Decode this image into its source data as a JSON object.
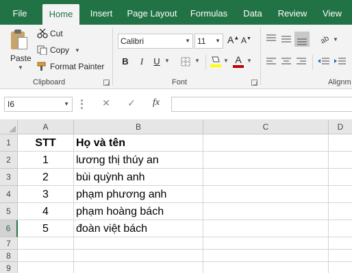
{
  "tabs": [
    "File",
    "Home",
    "Insert",
    "Page Layout",
    "Formulas",
    "Data",
    "Review",
    "View"
  ],
  "active_tab": "Home",
  "clipboard": {
    "paste_label": "Paste",
    "cut_label": "Cut",
    "copy_label": "Copy",
    "format_painter_label": "Format Painter",
    "group_label": "Clipboard"
  },
  "font": {
    "font_name": "Calibri",
    "font_size": "11",
    "bold": "B",
    "italic": "I",
    "underline": "U",
    "grow": "A",
    "shrink": "A",
    "font_color_letter": "A",
    "group_label": "Font"
  },
  "alignment": {
    "group_label": "Alignm"
  },
  "formula_bar": {
    "name_box": "I6",
    "fx_label": "fx",
    "formula": ""
  },
  "columns": [
    "A",
    "B",
    "C",
    "D"
  ],
  "rows": [
    "1",
    "2",
    "3",
    "4",
    "5",
    "6",
    "7",
    "8",
    "9"
  ],
  "active_row": "6",
  "sheet": {
    "header": {
      "stt": "STT",
      "name": "Họ và tên"
    },
    "records": [
      {
        "stt": "1",
        "name": "lương thị thúy an"
      },
      {
        "stt": "2",
        "name": "bùi quỳnh anh"
      },
      {
        "stt": "3",
        "name": "phạm phương anh"
      },
      {
        "stt": "4",
        "name": "phạm hoàng bách"
      },
      {
        "stt": "5",
        "name": "đoàn việt bách"
      }
    ]
  },
  "colors": {
    "excel_green": "#217346",
    "font_color_bar": "#c00000",
    "fill_color_bar": "#ffff00"
  }
}
